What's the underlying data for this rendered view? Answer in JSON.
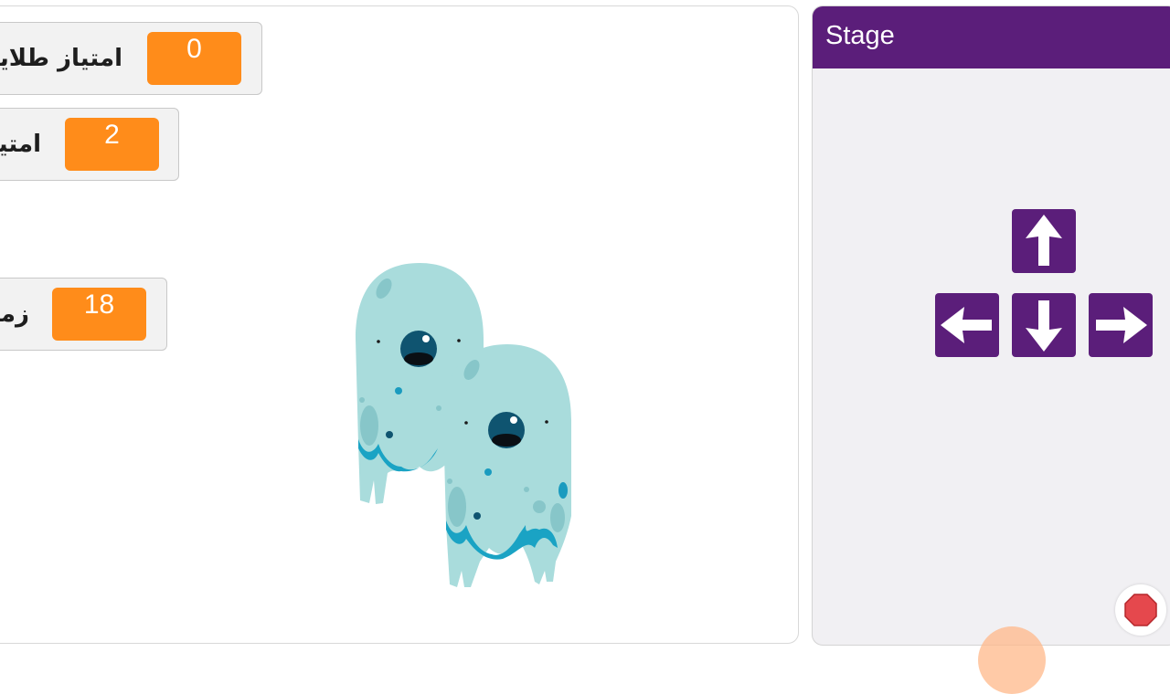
{
  "monitors": [
    {
      "label": "امتیاز طلایی",
      "value": "0"
    },
    {
      "label": "امتیاز",
      "value": "2"
    },
    {
      "label": "زمان",
      "value": "18"
    }
  ],
  "panel": {
    "title": "Stage",
    "header_color": "#5b1e7a"
  },
  "controls": {
    "keys": [
      "up-arrow-icon",
      "left-arrow-icon",
      "down-arrow-icon",
      "right-arrow-icon"
    ],
    "stop": "stop-icon"
  },
  "sprites": [
    "ghost-monster",
    "ghost-monster"
  ],
  "colors": {
    "monitor_value_bg": "#ff8c1a",
    "key_bg": "#5b1e7a",
    "stop": "#e5484d",
    "monster_body": "#a9dcdc",
    "monster_drip": "#1aa3c4"
  }
}
